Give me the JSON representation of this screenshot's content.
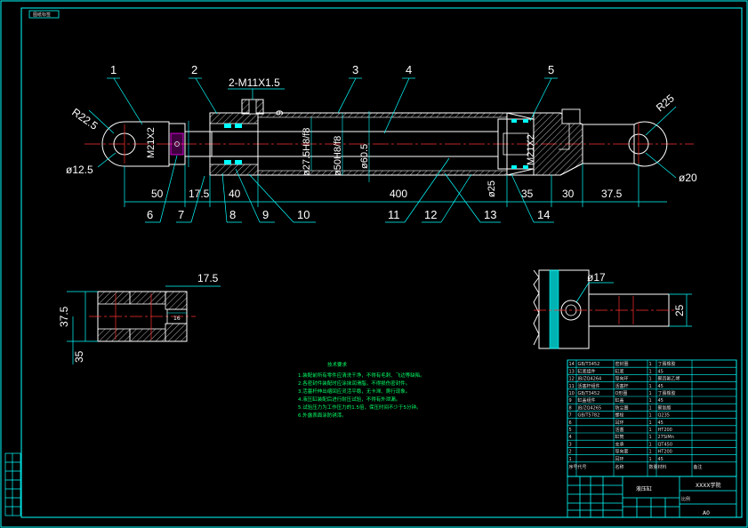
{
  "sheet": {
    "tab_label": "图纸标签",
    "border_color": "#00ffff",
    "line_color": "#ffffff",
    "center_color": "#ff3030",
    "hatch_color": "#ffffff",
    "leader_color": "#00ffff",
    "notes_color": "#00ff66",
    "magenta": "#ff00ff"
  },
  "balloons": [
    {
      "n": "1"
    },
    {
      "n": "2"
    },
    {
      "n": "3"
    },
    {
      "n": "4"
    },
    {
      "n": "5"
    },
    {
      "n": "6"
    },
    {
      "n": "7"
    },
    {
      "n": "8"
    },
    {
      "n": "9"
    },
    {
      "n": "10"
    },
    {
      "n": "11"
    },
    {
      "n": "12"
    },
    {
      "n": "13"
    },
    {
      "n": "14"
    }
  ],
  "dims": {
    "thread_ports": "2-M11X1.5",
    "r_left": "R22.5",
    "r_right": "R25",
    "d_left": "ø12.5",
    "d_right": "ø20",
    "m_left": "M21X2",
    "m_right": "M21X2",
    "bore_a": "ø27.5H8/f8",
    "bore_b": "ø50H8/f8",
    "bore_c": "ø60.5",
    "piston": "ø25",
    "h9": "9",
    "len_50": "50",
    "len_175": "17.5",
    "len_40": "40",
    "len_400": "400",
    "len_35": "35",
    "len_30": "30",
    "len_375": "37.5"
  },
  "detail_left": {
    "w": "17.5",
    "h1": "37.5",
    "h2": "35",
    "inner": "16"
  },
  "detail_right": {
    "hole": "ø17",
    "height": "25"
  },
  "notes": {
    "title": "技术要求",
    "lines": [
      "1.装配前所有零件应清洗干净，不得有毛刺、飞边等缺陷。",
      "2.各密封件装配时应涂抹润滑脂，不得损伤密封件。",
      "3.活塞杆伸出缩回应灵活平稳，无卡滞、爬行现象。",
      "4.液压缸装配后进行耐压试验，不得有外泄漏。",
      "5.试验压力为工作压力的1.5倍，保压时间不少于5分钟。",
      "6.外露表面涂防锈漆。"
    ]
  },
  "bom": {
    "rows": [
      {
        "no": "14",
        "code": "GB/T3452",
        "name": "密封圈",
        "qty": "1",
        "mat": "丁腈橡胶"
      },
      {
        "no": "13",
        "code": "缸底组件",
        "name": "缸底",
        "qty": "1",
        "mat": "45"
      },
      {
        "no": "12",
        "code": "JB/ZQ4264",
        "name": "导向环",
        "qty": "1",
        "mat": "聚四氟乙烯"
      },
      {
        "no": "11",
        "code": "活塞杆组件",
        "name": "活塞杆",
        "qty": "1",
        "mat": "45"
      },
      {
        "no": "10",
        "code": "GB/T3452",
        "name": "O形圈",
        "qty": "1",
        "mat": "丁腈橡胶"
      },
      {
        "no": "9",
        "code": "缸盖组件",
        "name": "缸盖",
        "qty": "1",
        "mat": "45"
      },
      {
        "no": "8",
        "code": "JB/ZQ4265",
        "name": "防尘圈",
        "qty": "1",
        "mat": "聚氨酯"
      },
      {
        "no": "7",
        "code": "GB/T5782",
        "name": "螺栓",
        "qty": "1",
        "mat": "Q235"
      },
      {
        "no": "6",
        "code": "",
        "name": "耳环",
        "qty": "1",
        "mat": "45"
      },
      {
        "no": "5",
        "code": "",
        "name": "活塞",
        "qty": "1",
        "mat": "HT200"
      },
      {
        "no": "4",
        "code": "",
        "name": "缸筒",
        "qty": "1",
        "mat": "27SiMn"
      },
      {
        "no": "3",
        "code": "",
        "name": "支承",
        "qty": "1",
        "mat": "QT450"
      },
      {
        "no": "2",
        "code": "",
        "name": "导向套",
        "qty": "1",
        "mat": "HT200"
      },
      {
        "no": "1",
        "code": "",
        "name": "耳环",
        "qty": "1",
        "mat": "45"
      }
    ],
    "headers": [
      "序号",
      "代号",
      "名称",
      "数量",
      "材料",
      "备注"
    ]
  },
  "title_block": {
    "title": "XXXX学院",
    "drawing_name": "液压缸",
    "sheet_size": "A0",
    "scale_label": "比例"
  }
}
